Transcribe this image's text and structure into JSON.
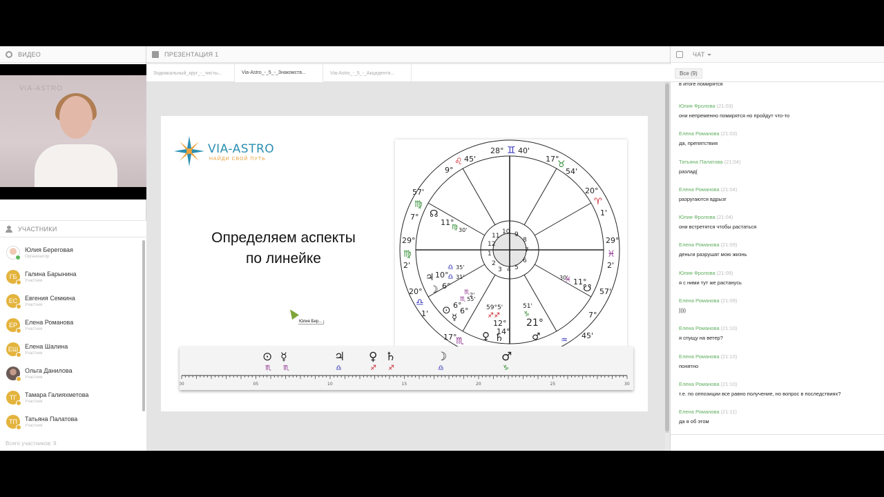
{
  "video_panel": {
    "title": "ВИДЕО",
    "watermark": "VIA-ASTRO"
  },
  "participants_panel": {
    "title": "УЧАСТНИКИ",
    "items": [
      {
        "name": "Юлия Береговая",
        "role": "Организатор",
        "initials": ""
      },
      {
        "name": "Галина Барынина",
        "role": "Участник",
        "initials": "ГБ"
      },
      {
        "name": "Евгения Семкина",
        "role": "Участник",
        "initials": "ЕС"
      },
      {
        "name": "Елена Романова",
        "role": "Участник",
        "initials": "ЕР"
      },
      {
        "name": "Елена Шалина",
        "role": "Участник",
        "initials": "ЕШ"
      },
      {
        "name": "Ольга Данилова",
        "role": "Участник",
        "initials": ""
      },
      {
        "name": "Тамара Галияхметова",
        "role": "Участник",
        "initials": "ТГ"
      },
      {
        "name": "Татьяна Палатова",
        "role": "Участник",
        "initials": "ТП"
      }
    ],
    "total": "Всего участников: 9"
  },
  "presentation": {
    "title": "ПРЕЗЕНТАЦИЯ 1",
    "tabs": [
      {
        "label": "Зодиакальный_круг_-_чисты..."
      },
      {
        "label": "Via-Astro_-_5_-_Знакомств..."
      },
      {
        "label": "Via-Astro_-_5_-_Акцидентя..."
      }
    ],
    "slide": {
      "logo_title": "VIA-ASTRO",
      "logo_subtitle": "НАЙДИ СВОЙ ПУТЬ",
      "heading_line1": "Определяем аспекты",
      "heading_line2": "по линейке",
      "cursor_label": "Юлия Бер..."
    },
    "ruler_ticks": [
      "00",
      "05",
      "10",
      "15",
      "20",
      "25",
      "30"
    ]
  },
  "chat": {
    "title": "ЧАТ",
    "filter": "Все (9)",
    "messages": [
      {
        "author": "",
        "time": "",
        "text": "в итоге помирятся"
      },
      {
        "author": "Юлия Фролова",
        "time": "(21:03)",
        "text": "они непременно помирятся но пройдут что-то"
      },
      {
        "author": "Елена Романова",
        "time": "(21:03)",
        "text": "да, препятствия"
      },
      {
        "author": "Татьяна Палатова",
        "time": "(21:04)",
        "text": "разлад("
      },
      {
        "author": "Елена Романова",
        "time": "(21:04)",
        "text": "разругаются вдрызг"
      },
      {
        "author": "Юлия Фролова",
        "time": "(21:04)",
        "text": "они встретятся чтобы растаться"
      },
      {
        "author": "Елена Романова",
        "time": "(21:09)",
        "text": "деньги разрушат мою жизнь"
      },
      {
        "author": "Юлия Фролова",
        "time": "(21:09)",
        "text": "я с ними тут же растанусь"
      },
      {
        "author": "Елена Романова",
        "time": "(21:09)",
        "text": "))))"
      },
      {
        "author": "Елена Романова",
        "time": "(21:10)",
        "text": "я спущу на ветер?"
      },
      {
        "author": "Елена Романова",
        "time": "(21:10)",
        "text": "понятно"
      },
      {
        "author": "Елена Романова",
        "time": "(21:10)",
        "text": "т.е. по оппозиции все равно получение, но вопрос в последствиях?"
      },
      {
        "author": "Елена Романова",
        "time": "(21:11)",
        "text": "да я об этом"
      }
    ]
  },
  "colors": {
    "accent_green": "#5fae5f",
    "avatar_yellow": "#e3b33c",
    "logo_blue": "#2b8fb2",
    "logo_orange": "#e9a13b"
  }
}
